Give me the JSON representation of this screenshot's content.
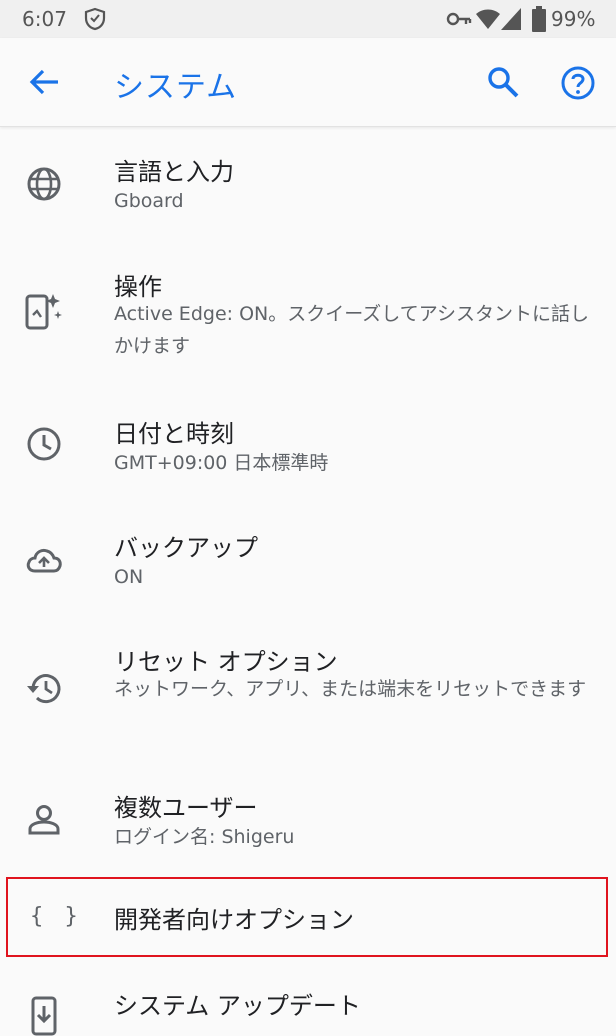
{
  "status": {
    "time": "6:07",
    "battery": "99%"
  },
  "appbar": {
    "title": "システム"
  },
  "items": [
    {
      "title": "言語と入力",
      "subtitle": "Gboard",
      "icon": "globe-icon"
    },
    {
      "title": "操作",
      "subtitle": "Active Edge: ON。スクイーズしてアシスタントに話しかけます",
      "icon": "phone-gesture-icon"
    },
    {
      "title": "日付と時刻",
      "subtitle": "GMT+09:00 日本標準時",
      "icon": "clock-icon"
    },
    {
      "title": "バックアップ",
      "subtitle": "ON",
      "icon": "cloud-upload-icon"
    },
    {
      "title": "リセット オプション",
      "subtitle": "ネットワーク、アプリ、または端末をリセットできます",
      "icon": "history-icon"
    },
    {
      "title": "複数ユーザー",
      "subtitle": "ログイン名: Shigeru",
      "icon": "person-icon"
    },
    {
      "title": "開発者向けオプション",
      "icon": "braces-icon"
    },
    {
      "title": "システム アップデート",
      "icon": "system-update-icon"
    }
  ],
  "colors": {
    "accent": "#1a73e8",
    "highlight": "#e0141e"
  }
}
